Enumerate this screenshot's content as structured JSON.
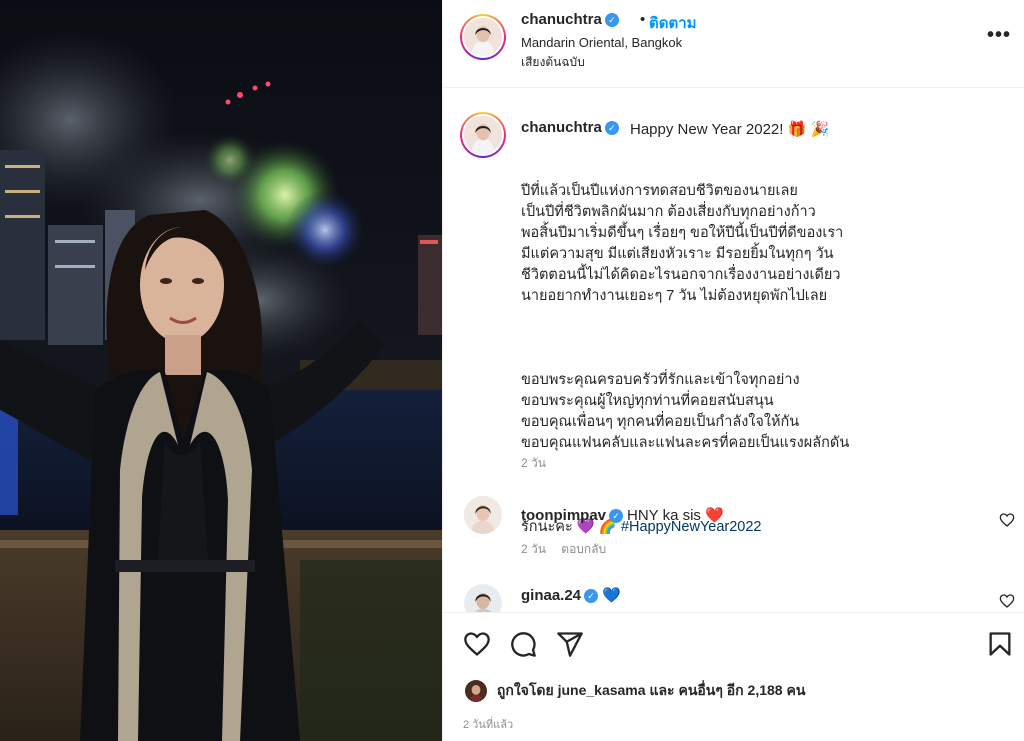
{
  "post_header": {
    "username": "chanuchtra",
    "separator": "•",
    "follow_label": "ติดตาม",
    "location": "Mandarin Oriental, Bangkok",
    "audio": "เสียงต้นฉบับ",
    "more_icon": "more-options-icon"
  },
  "caption": {
    "username": "chanuchtra",
    "title": "Happy New Year 2022! 🎁 🎉",
    "body_p1": "ปีที่แล้วเป็นปีแห่งการทดสอบชีวิตของนายเลย\nเป็นปีที่ชีวิตพลิกผันมาก ต้องเสี่ยงกับทุกอย่างก้าว\nพอสิ้นปีมาเริ่มดีขึ้นๆ เรื่อยๆ ขอให้ปีนี้เป็นปีที่ดีของเรา\nมีแต่ความสุข มีแต่เสียงหัวเราะ มีรอยยิ้มในทุกๆ วัน\nชีวิตตอนนี้ไม่ได้คิดอะไรนอกจากเรื่องงานอย่างเดียว\nนายอยากทำงานเยอะๆ 7 วัน ไม่ต้องหยุดพักไปเลย",
    "body_p2": "ขอบพระคุณครอบครัวที่รักและเข้าใจทุกอย่าง\nขอบพระคุณผู้ใหญ่ทุกท่านที่คอยสนับสนุน\nขอบคุณเพื่อนๆ ทุกคนที่คอยเป็นกำลังใจให้กัน\nขอบคุณแฟนคลับและแฟนละครที่คอยเป็นแรงผลักดัน",
    "closing": "รักนะคะ 💜 🌈 ",
    "hashtag": "#HappyNewYear2022",
    "time": "2 วัน"
  },
  "comments": [
    {
      "username": "toonpimpav",
      "text": "HNY ka sis ❤️",
      "time": "2 วัน",
      "reply_label": "ตอบกลับ"
    },
    {
      "username": "ginaa.24",
      "text": "💙",
      "time": "",
      "reply_label": ""
    }
  ],
  "actions": {
    "like_icon": "heart-icon",
    "comment_icon": "comment-icon",
    "share_icon": "share-icon",
    "save_icon": "bookmark-icon"
  },
  "likes": {
    "prefix": "ถูกใจโดย",
    "user": "june_kasama",
    "and_others": "และ คนอื่นๆ อีก 2,188 คน"
  },
  "posted_time": "2 วันที่แล้ว",
  "colors": {
    "follow": "#0095f6",
    "verified": "#3897f0",
    "hashtag": "#00376b",
    "like_red": "#ed4956",
    "muted": "#8e8e8e"
  }
}
